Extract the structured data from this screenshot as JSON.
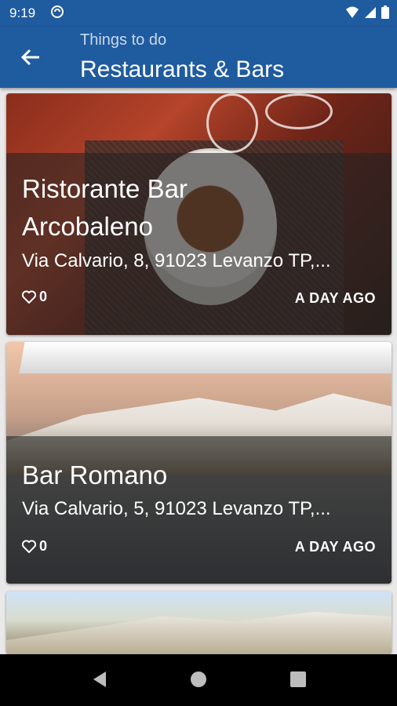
{
  "status_bar": {
    "time": "9:19"
  },
  "app_bar": {
    "subtitle": "Things to do",
    "title": "Restaurants & Bars"
  },
  "cards": [
    {
      "name_line1": "Ristorante Bar",
      "name_line2": "Arcobaleno",
      "address": "Via Calvario, 8, 91023 Levanzo TP,...",
      "likes": "0",
      "time_ago": "A DAY AGO"
    },
    {
      "name_line1": "Bar Romano",
      "address": "Via Calvario, 5, 91023 Levanzo TP,...",
      "likes": "0",
      "time_ago": "A DAY AGO"
    }
  ],
  "colors": {
    "primary": "#1f5b9f",
    "overlay": "rgba(35,35,35,0.58)"
  },
  "icons": [
    "sync-icon",
    "wifi-icon",
    "signal-icon",
    "battery-icon",
    "back-arrow-icon",
    "heart-icon",
    "nav-back-icon",
    "nav-home-icon",
    "nav-recents-icon"
  ]
}
